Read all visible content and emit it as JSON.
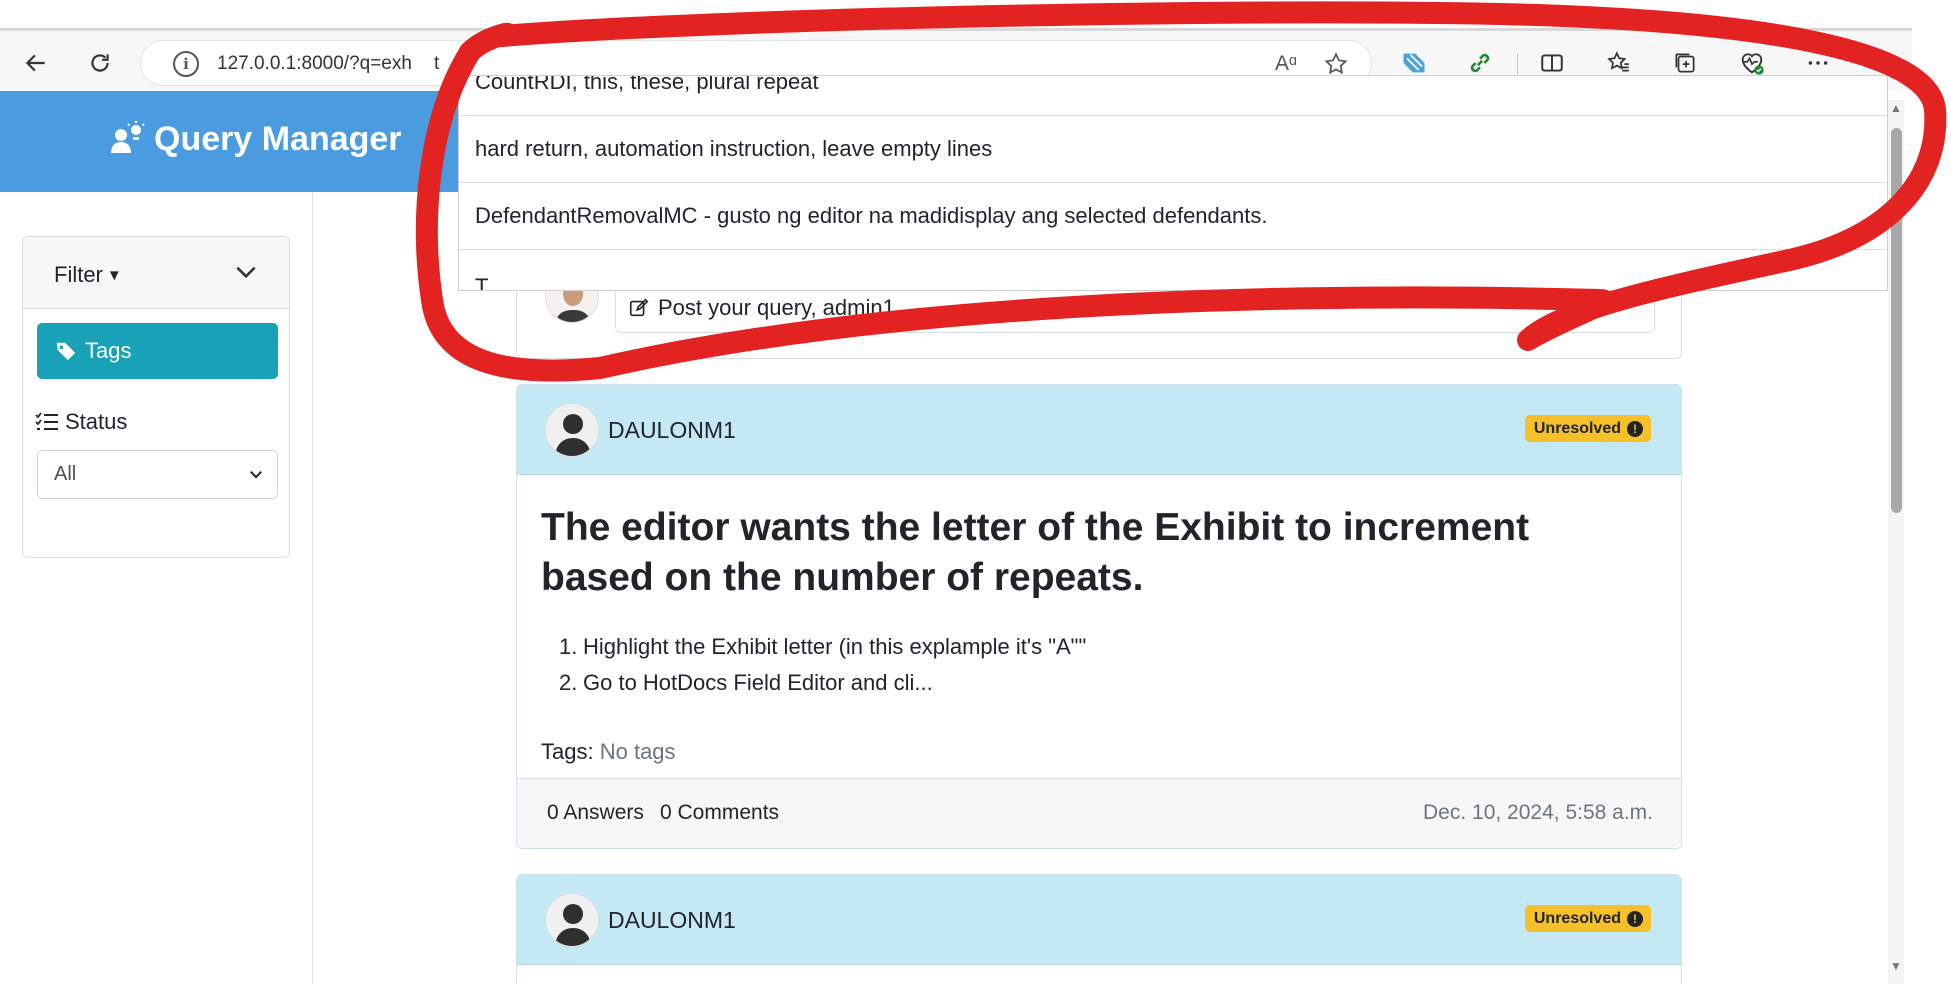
{
  "browser": {
    "url": "127.0.0.1:8000/?q=exh",
    "url_tail": "t",
    "icons": [
      "back-icon",
      "refresh-icon",
      "info-icon",
      "read-aloud-icon",
      "favorite-star-icon",
      "extension-icon",
      "link-icon",
      "split-screen-icon",
      "favorites-icon",
      "collections-icon",
      "browser-essentials-icon",
      "more-icon"
    ],
    "read_aloud_glyph": "Aᵅ"
  },
  "app": {
    "title": "Query Manager",
    "brand_color": "#4a9be0"
  },
  "autocomplete": {
    "items": [
      "CountRDI, this, these, plural repeat",
      "hard return, automation instruction, leave empty lines",
      "DefendantRemovalMC - gusto ng editor na madidisplay ang selected defendants.",
      "T"
    ]
  },
  "sidebar": {
    "filter_label": "Filter",
    "tags_button": "Tags",
    "status_label": "Status",
    "status_selected": "All",
    "tags_color": "#17a2b8"
  },
  "composer": {
    "placeholder": "Post your query, admin1"
  },
  "queries": [
    {
      "user": "DAULONM1",
      "status": "Unresolved",
      "title": "The editor wants the letter of the Exhibit to increment based on the number of repeats.",
      "steps": [
        {
          "num": "1.",
          "text": "Highlight the Exhibit letter (in this explample it's \"A\"\""
        },
        {
          "num": "2.",
          "text": "Go to HotDocs Field Editor and cli..."
        }
      ],
      "tags_label": "Tags:",
      "tags_value": "No tags",
      "answers": "0 Answers",
      "comments": "0 Comments",
      "date": "Dec. 10, 2024, 5:58 a.m."
    },
    {
      "user": "DAULONM1",
      "status": "Unresolved"
    }
  ],
  "colors": {
    "card_header": "#c5e9f4",
    "badge": "#f6c02a",
    "annotation": "#e32222"
  }
}
